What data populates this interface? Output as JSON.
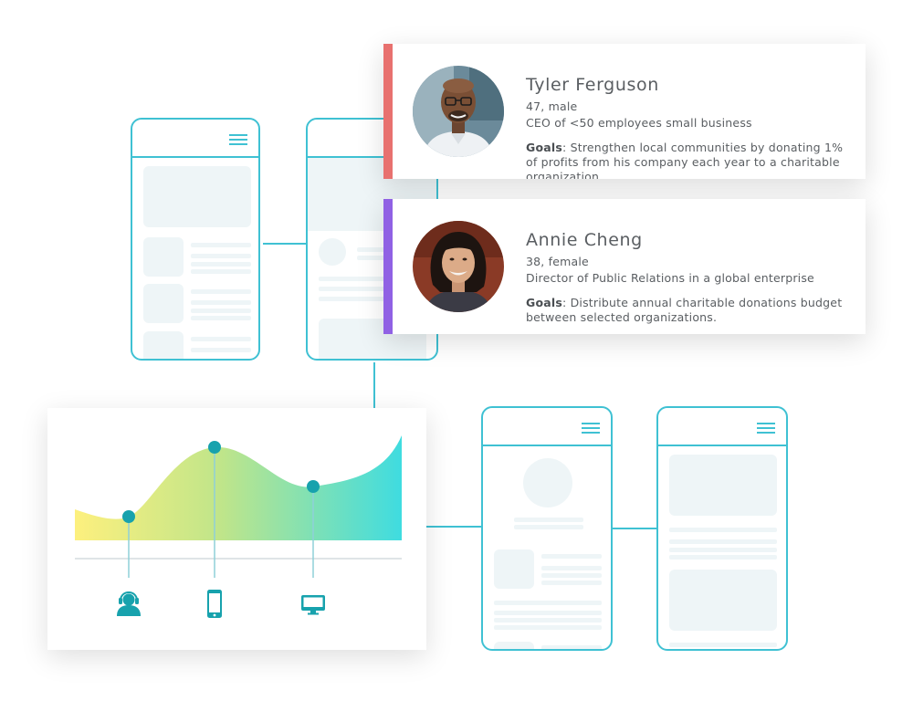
{
  "colors": {
    "wireframe": "#3fc1d3",
    "placeholder": "#eef5f7",
    "marker": "#17a2ad",
    "persona1_accent": "#e8716f",
    "persona2_accent": "#9061e4",
    "gradient_start": "#fdf07e",
    "gradient_mid": "#bfe58a",
    "gradient_end": "#3fdce0"
  },
  "personas": [
    {
      "name": "Tyler Ferguson",
      "age_gender": "47, male",
      "role": "CEO of <50 employees small business",
      "goals_label": "Goals",
      "goals": ": Strengthen local communities by donating 1% of profits from his company each year to a charitable organization."
    },
    {
      "name": "Annie Cheng",
      "age_gender": "38, female",
      "role": "Director of Public Relations in a global enterprise",
      "goals_label": "Goals",
      "goals": ": Distribute annual charitable donations budget between selected organizations."
    }
  ],
  "journey": {
    "touchpoints": [
      "support-agent-icon",
      "smartphone-icon",
      "desktop-monitor-icon"
    ]
  }
}
